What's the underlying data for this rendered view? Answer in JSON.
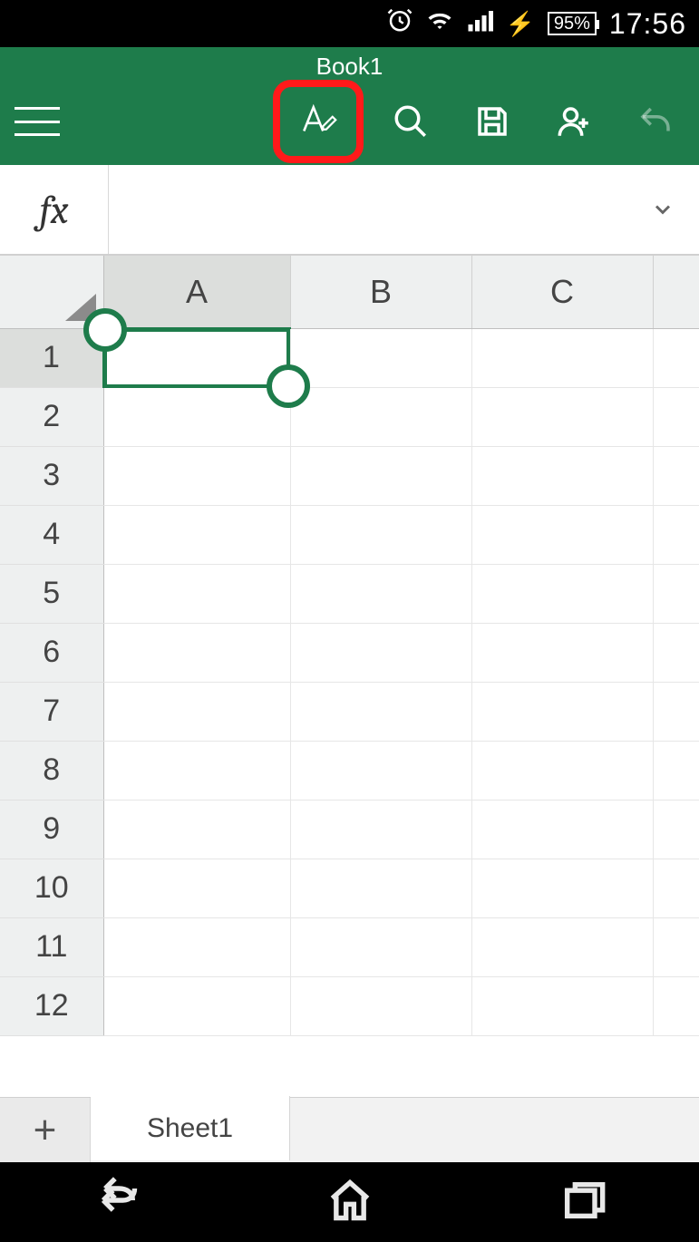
{
  "status": {
    "battery_text": "95%",
    "time": "17:56"
  },
  "app": {
    "title": "Book1"
  },
  "formula": {
    "fx_label": "fx",
    "value": ""
  },
  "grid": {
    "columns": [
      "A",
      "B",
      "C",
      ""
    ],
    "rows": [
      "1",
      "2",
      "3",
      "4",
      "5",
      "6",
      "7",
      "8",
      "9",
      "10",
      "11",
      "12"
    ],
    "selected_cell": "A1"
  },
  "sheets": {
    "active": "Sheet1",
    "add_label": "+"
  },
  "icons": {
    "hamburger": "menu-icon",
    "edit": "font-edit-icon",
    "search": "search-icon",
    "save": "save-icon",
    "share": "add-person-icon",
    "undo": "undo-icon",
    "expand": "chevron-down-icon",
    "back": "back-icon",
    "home": "home-icon",
    "recents": "recents-icon",
    "alarm": "alarm-icon",
    "wifi": "wifi-icon",
    "signal": "signal-icon",
    "charge": "charging-icon"
  }
}
